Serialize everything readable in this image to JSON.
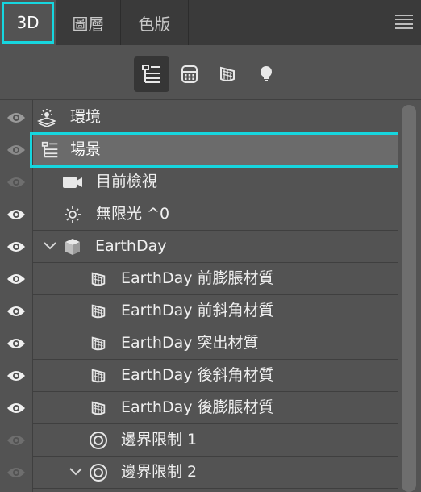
{
  "tabs": [
    {
      "label": "3D",
      "active": true
    },
    {
      "label": "圖層",
      "active": false
    },
    {
      "label": "色版",
      "active": false
    }
  ],
  "toolbar": {
    "buttons": [
      {
        "icon": "scene-tree-icon",
        "active": true
      },
      {
        "icon": "mesh-icon",
        "active": false
      },
      {
        "icon": "material-icon",
        "active": false
      },
      {
        "icon": "light-bulb-icon",
        "active": false
      }
    ]
  },
  "rows": [
    {
      "label": "環境",
      "icon": "environment-icon",
      "visible": true
    },
    {
      "label": "場景",
      "icon": "scene-icon",
      "visible": true,
      "selected": true
    },
    {
      "label": "目前檢視",
      "icon": "camera-icon",
      "visible": false
    },
    {
      "label": "無限光 ^0",
      "icon": "infinite-light-icon",
      "visible": true
    },
    {
      "label": "EarthDay",
      "icon": "mesh-icon",
      "visible": true,
      "expanded": true
    },
    {
      "label": "EarthDay 前膨脹材質",
      "icon": "material-icon",
      "visible": true
    },
    {
      "label": "EarthDay 前斜角材質",
      "icon": "material-icon",
      "visible": true
    },
    {
      "label": "EarthDay 突出材質",
      "icon": "material-icon",
      "visible": true
    },
    {
      "label": "EarthDay 後斜角材質",
      "icon": "material-icon",
      "visible": true
    },
    {
      "label": "EarthDay 後膨脹材質",
      "icon": "material-icon",
      "visible": true
    },
    {
      "label": "邊界限制 1",
      "icon": "constraint-icon",
      "visible": false
    },
    {
      "label": "邊界限制 2",
      "icon": "constraint-icon",
      "visible": false,
      "expanded": true
    }
  ],
  "colors": {
    "panel_bg": "#535353",
    "tabbar_bg": "#3a3a3a",
    "highlight": "#16d6df",
    "selected_row": "#6b6b6b"
  }
}
